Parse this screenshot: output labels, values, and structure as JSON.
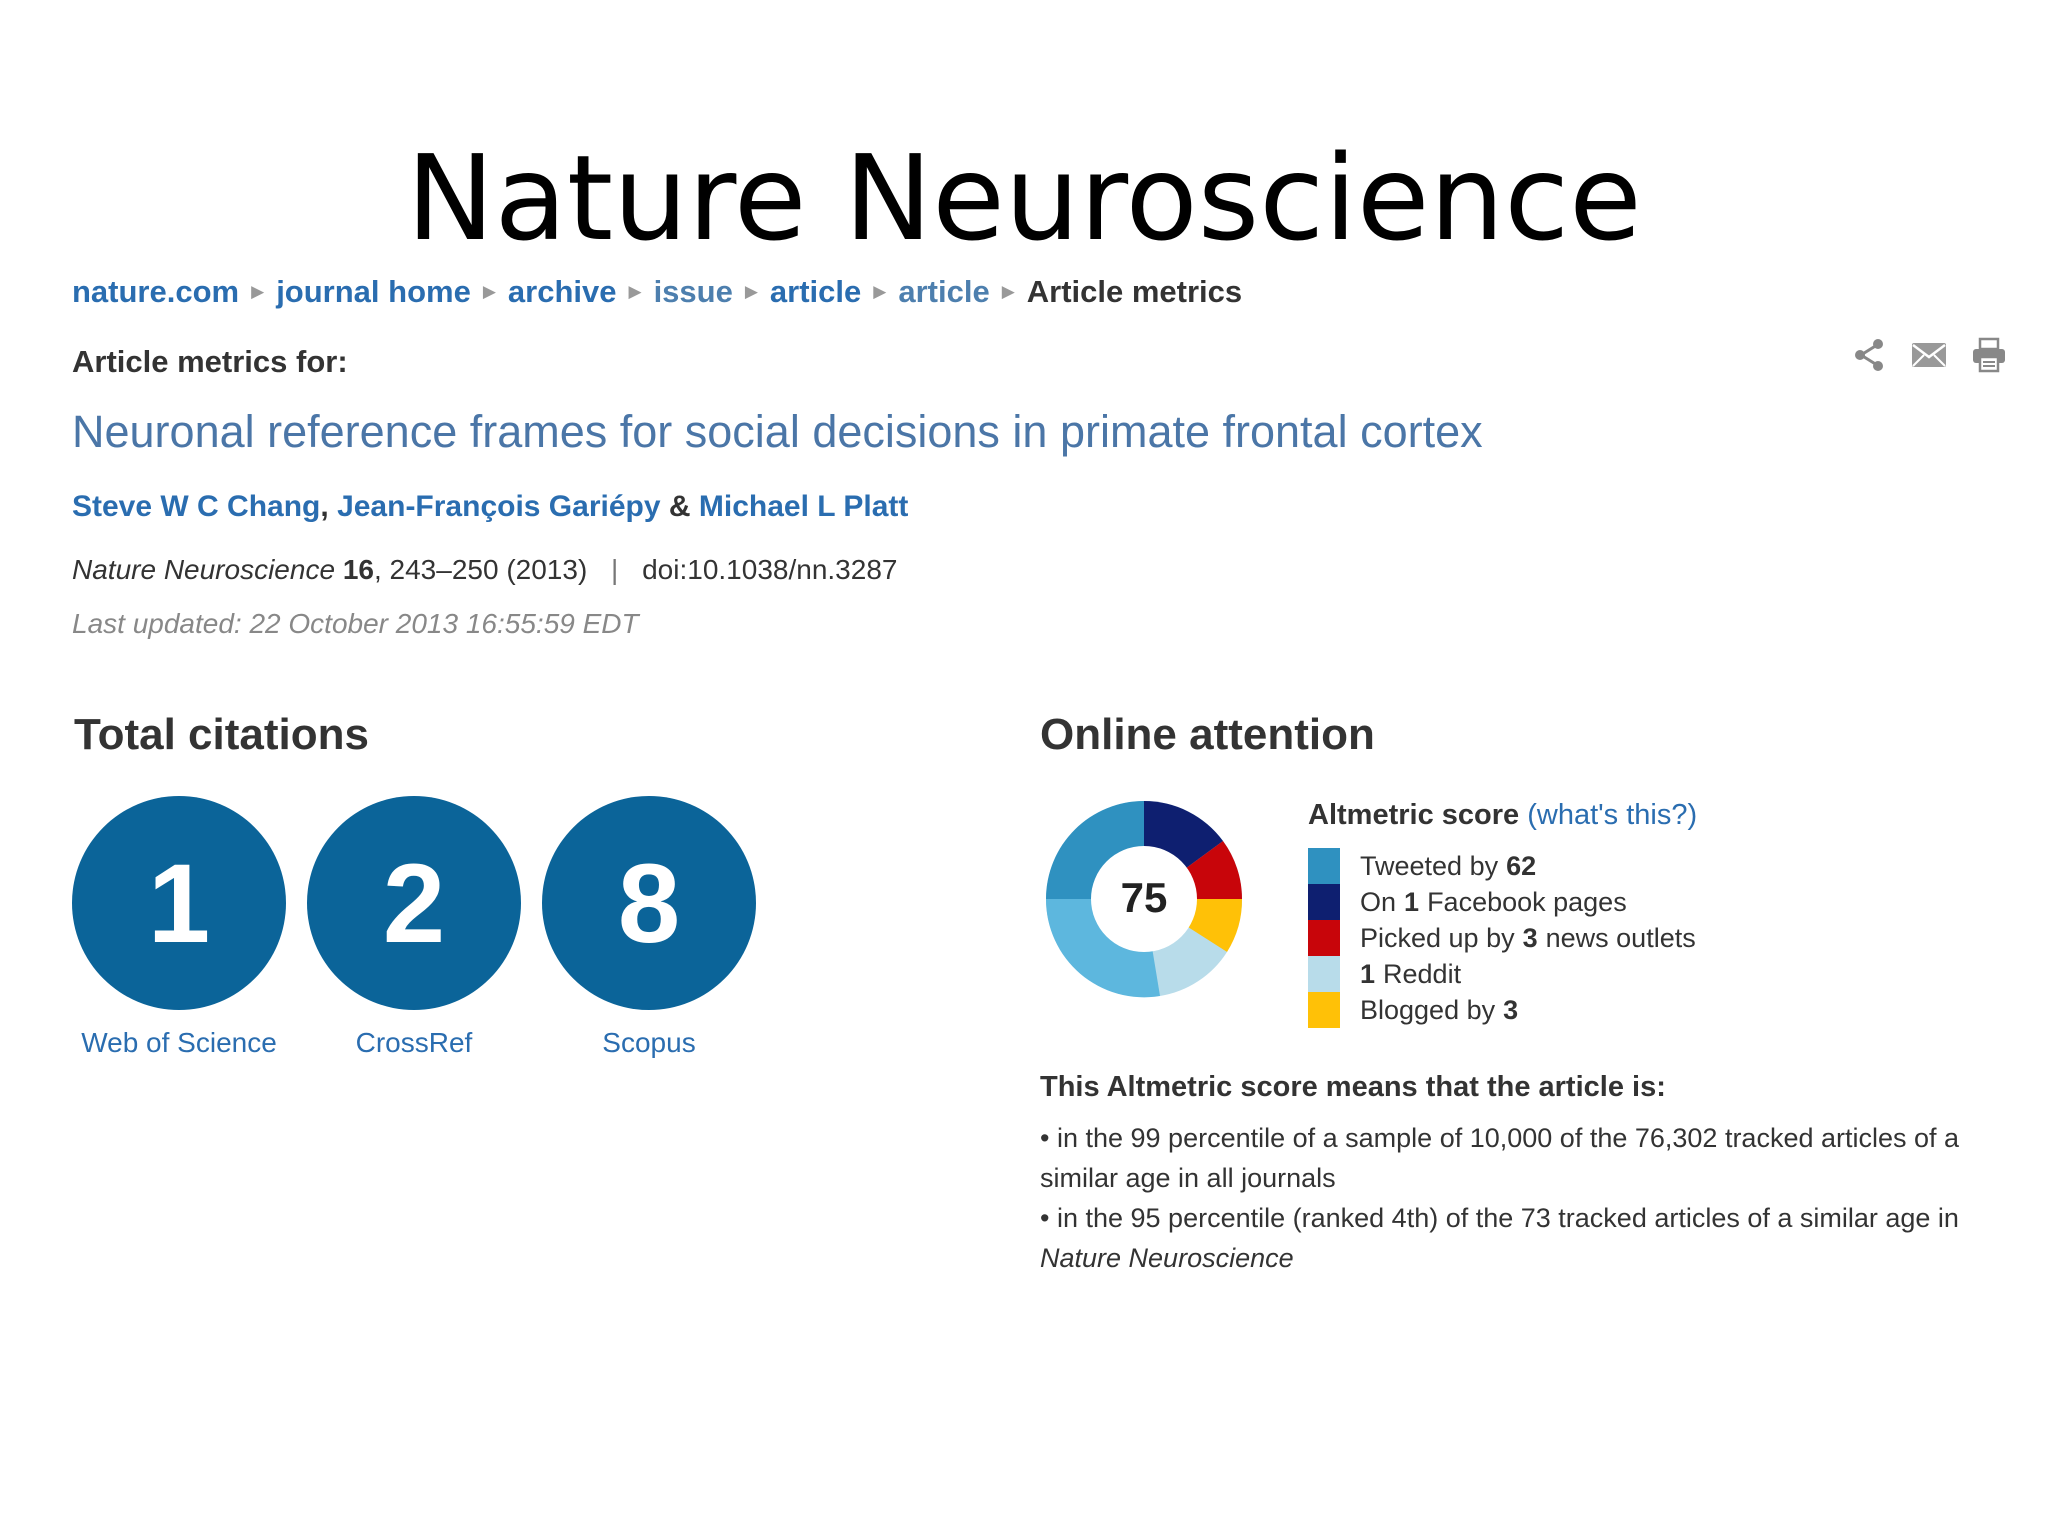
{
  "slide": {
    "title": "Nature Neuroscience"
  },
  "breadcrumb": [
    {
      "label": "nature.com"
    },
    {
      "label": "journal home"
    },
    {
      "label": "archive"
    },
    {
      "label": "issue"
    },
    {
      "label": "article"
    },
    {
      "label": "article"
    },
    {
      "label": "Article metrics"
    }
  ],
  "header": {
    "metrics_for": "Article metrics for:"
  },
  "toolbar": {
    "share_icon": "share-icon",
    "email_icon": "email-icon",
    "print_icon": "print-icon"
  },
  "article": {
    "title": "Neuronal reference frames for social decisions in primate frontal cortex",
    "authors": [
      "Steve W C Chang",
      "Jean-François Gariépy",
      "Michael L Platt"
    ],
    "author_sep": ",",
    "author_amp": "&",
    "journal": "Nature Neuroscience",
    "volume": "16",
    "pages": "243–250",
    "year": "(2013)",
    "doi": "doi:10.1038/nn.3287",
    "last_updated": "Last updated: 22 October 2013 16:55:59 EDT"
  },
  "citations": {
    "heading": "Total citations",
    "items": [
      {
        "count": "1",
        "source": "Web of Science"
      },
      {
        "count": "2",
        "source": "CrossRef"
      },
      {
        "count": "8",
        "source": "Scopus"
      }
    ]
  },
  "attention": {
    "heading": "Online attention",
    "score": "75",
    "score_label": "Altmetric score",
    "whats_this": "(what's this?)",
    "legend": [
      {
        "prefix": "Tweeted by",
        "value": "62",
        "suffix": "",
        "color": "#2f91c0"
      },
      {
        "prefix": "On",
        "value": "1",
        "suffix": "Facebook pages",
        "color": "#0e1f70"
      },
      {
        "prefix": "Picked up by",
        "value": "3",
        "suffix": "news outlets",
        "color": "#c8050a"
      },
      {
        "prefix": "",
        "value": "1",
        "suffix": "Reddit",
        "color": "#b8dcea"
      },
      {
        "prefix": "Blogged by",
        "value": "3",
        "suffix": "",
        "color": "#ffc107"
      }
    ],
    "means_heading": "This Altmetric score means that the article is:",
    "bullets": [
      {
        "text": "in the 99 percentile of a sample of 10,000 of the 76,302 tracked articles of a similar age in all journals"
      },
      {
        "text": "in the 95 percentile (ranked 4th) of the 73 tracked articles of a similar age in",
        "journal": "Nature Neuroscience"
      }
    ]
  }
}
